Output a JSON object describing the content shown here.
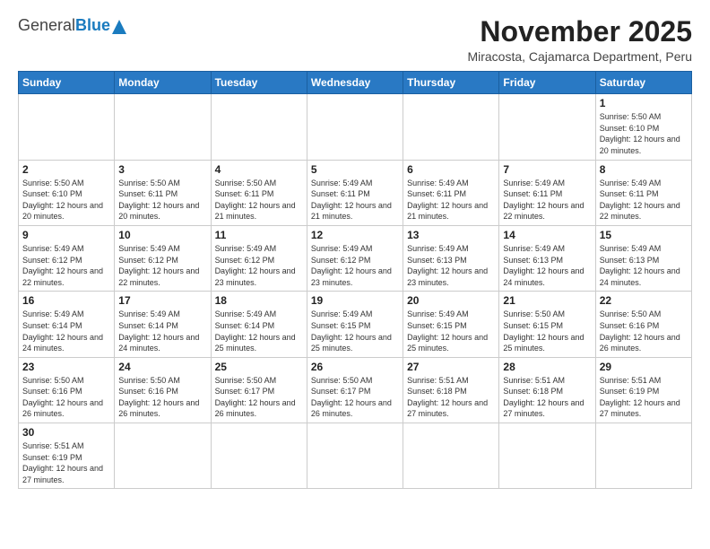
{
  "header": {
    "logo_general": "General",
    "logo_blue": "Blue",
    "month_title": "November 2025",
    "location": "Miracosta, Cajamarca Department, Peru"
  },
  "weekdays": [
    "Sunday",
    "Monday",
    "Tuesday",
    "Wednesday",
    "Thursday",
    "Friday",
    "Saturday"
  ],
  "weeks": [
    [
      {
        "day": "",
        "info": ""
      },
      {
        "day": "",
        "info": ""
      },
      {
        "day": "",
        "info": ""
      },
      {
        "day": "",
        "info": ""
      },
      {
        "day": "",
        "info": ""
      },
      {
        "day": "",
        "info": ""
      },
      {
        "day": "1",
        "info": "Sunrise: 5:50 AM\nSunset: 6:10 PM\nDaylight: 12 hours\nand 20 minutes."
      }
    ],
    [
      {
        "day": "2",
        "info": "Sunrise: 5:50 AM\nSunset: 6:10 PM\nDaylight: 12 hours\nand 20 minutes."
      },
      {
        "day": "3",
        "info": "Sunrise: 5:50 AM\nSunset: 6:11 PM\nDaylight: 12 hours\nand 20 minutes."
      },
      {
        "day": "4",
        "info": "Sunrise: 5:50 AM\nSunset: 6:11 PM\nDaylight: 12 hours\nand 21 minutes."
      },
      {
        "day": "5",
        "info": "Sunrise: 5:49 AM\nSunset: 6:11 PM\nDaylight: 12 hours\nand 21 minutes."
      },
      {
        "day": "6",
        "info": "Sunrise: 5:49 AM\nSunset: 6:11 PM\nDaylight: 12 hours\nand 21 minutes."
      },
      {
        "day": "7",
        "info": "Sunrise: 5:49 AM\nSunset: 6:11 PM\nDaylight: 12 hours\nand 22 minutes."
      },
      {
        "day": "8",
        "info": "Sunrise: 5:49 AM\nSunset: 6:11 PM\nDaylight: 12 hours\nand 22 minutes."
      }
    ],
    [
      {
        "day": "9",
        "info": "Sunrise: 5:49 AM\nSunset: 6:12 PM\nDaylight: 12 hours\nand 22 minutes."
      },
      {
        "day": "10",
        "info": "Sunrise: 5:49 AM\nSunset: 6:12 PM\nDaylight: 12 hours\nand 22 minutes."
      },
      {
        "day": "11",
        "info": "Sunrise: 5:49 AM\nSunset: 6:12 PM\nDaylight: 12 hours\nand 23 minutes."
      },
      {
        "day": "12",
        "info": "Sunrise: 5:49 AM\nSunset: 6:12 PM\nDaylight: 12 hours\nand 23 minutes."
      },
      {
        "day": "13",
        "info": "Sunrise: 5:49 AM\nSunset: 6:13 PM\nDaylight: 12 hours\nand 23 minutes."
      },
      {
        "day": "14",
        "info": "Sunrise: 5:49 AM\nSunset: 6:13 PM\nDaylight: 12 hours\nand 24 minutes."
      },
      {
        "day": "15",
        "info": "Sunrise: 5:49 AM\nSunset: 6:13 PM\nDaylight: 12 hours\nand 24 minutes."
      }
    ],
    [
      {
        "day": "16",
        "info": "Sunrise: 5:49 AM\nSunset: 6:14 PM\nDaylight: 12 hours\nand 24 minutes."
      },
      {
        "day": "17",
        "info": "Sunrise: 5:49 AM\nSunset: 6:14 PM\nDaylight: 12 hours\nand 24 minutes."
      },
      {
        "day": "18",
        "info": "Sunrise: 5:49 AM\nSunset: 6:14 PM\nDaylight: 12 hours\nand 25 minutes."
      },
      {
        "day": "19",
        "info": "Sunrise: 5:49 AM\nSunset: 6:15 PM\nDaylight: 12 hours\nand 25 minutes."
      },
      {
        "day": "20",
        "info": "Sunrise: 5:49 AM\nSunset: 6:15 PM\nDaylight: 12 hours\nand 25 minutes."
      },
      {
        "day": "21",
        "info": "Sunrise: 5:50 AM\nSunset: 6:15 PM\nDaylight: 12 hours\nand 25 minutes."
      },
      {
        "day": "22",
        "info": "Sunrise: 5:50 AM\nSunset: 6:16 PM\nDaylight: 12 hours\nand 26 minutes."
      }
    ],
    [
      {
        "day": "23",
        "info": "Sunrise: 5:50 AM\nSunset: 6:16 PM\nDaylight: 12 hours\nand 26 minutes."
      },
      {
        "day": "24",
        "info": "Sunrise: 5:50 AM\nSunset: 6:16 PM\nDaylight: 12 hours\nand 26 minutes."
      },
      {
        "day": "25",
        "info": "Sunrise: 5:50 AM\nSunset: 6:17 PM\nDaylight: 12 hours\nand 26 minutes."
      },
      {
        "day": "26",
        "info": "Sunrise: 5:50 AM\nSunset: 6:17 PM\nDaylight: 12 hours\nand 26 minutes."
      },
      {
        "day": "27",
        "info": "Sunrise: 5:51 AM\nSunset: 6:18 PM\nDaylight: 12 hours\nand 27 minutes."
      },
      {
        "day": "28",
        "info": "Sunrise: 5:51 AM\nSunset: 6:18 PM\nDaylight: 12 hours\nand 27 minutes."
      },
      {
        "day": "29",
        "info": "Sunrise: 5:51 AM\nSunset: 6:19 PM\nDaylight: 12 hours\nand 27 minutes."
      }
    ],
    [
      {
        "day": "30",
        "info": "Sunrise: 5:51 AM\nSunset: 6:19 PM\nDaylight: 12 hours\nand 27 minutes."
      },
      {
        "day": "",
        "info": ""
      },
      {
        "day": "",
        "info": ""
      },
      {
        "day": "",
        "info": ""
      },
      {
        "day": "",
        "info": ""
      },
      {
        "day": "",
        "info": ""
      },
      {
        "day": "",
        "info": ""
      }
    ]
  ]
}
